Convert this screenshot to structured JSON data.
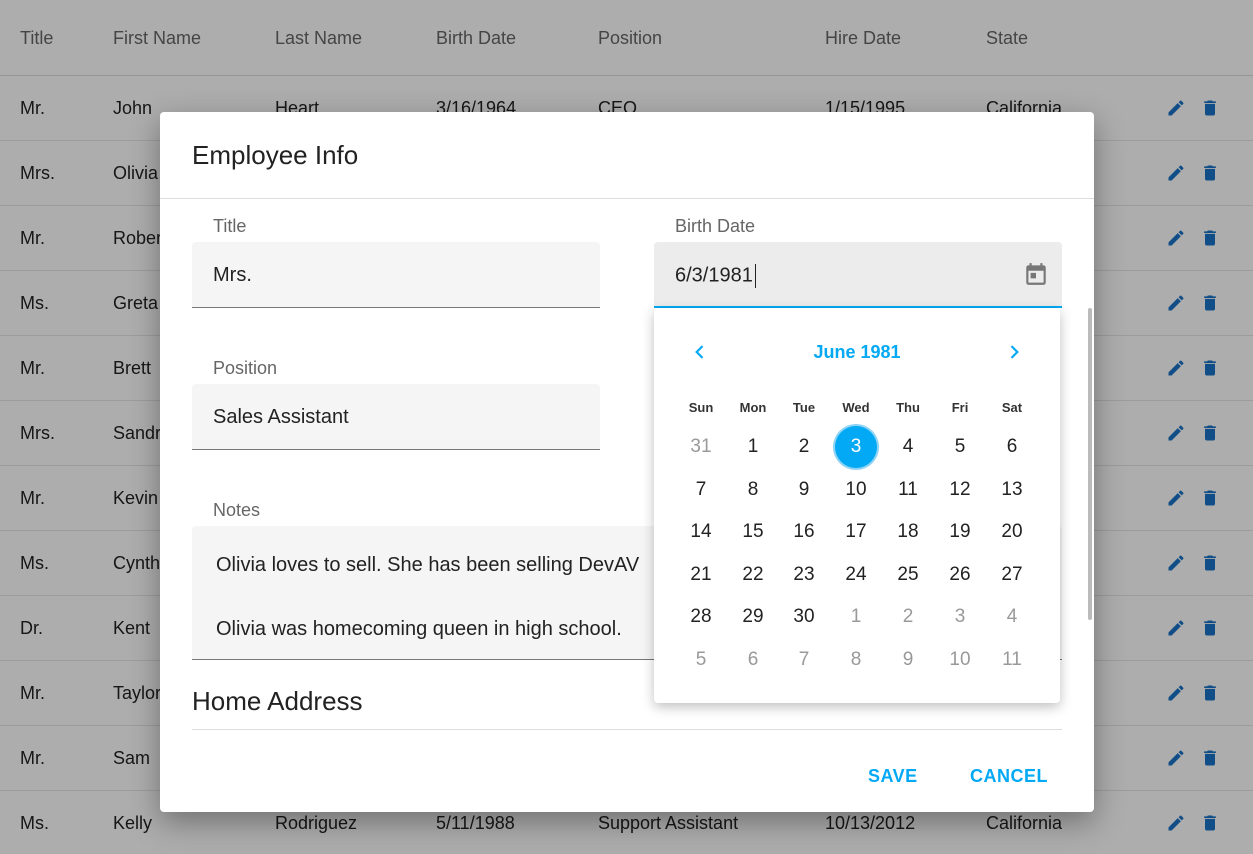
{
  "grid": {
    "columns": [
      "Title",
      "First Name",
      "Last Name",
      "Birth Date",
      "Position",
      "Hire Date",
      "State"
    ],
    "rows": [
      {
        "title": "Mr.",
        "first": "John",
        "last": "Heart",
        "birth": "3/16/1964",
        "position": "CEO",
        "hire": "1/15/1995",
        "state": "California"
      },
      {
        "title": "Mrs.",
        "first": "Olivia",
        "last": "",
        "birth": "",
        "position": "",
        "hire": "",
        "state": ""
      },
      {
        "title": "Mr.",
        "first": "Robert",
        "last": "",
        "birth": "",
        "position": "",
        "hire": "",
        "state": ""
      },
      {
        "title": "Ms.",
        "first": "Greta",
        "last": "",
        "birth": "",
        "position": "",
        "hire": "",
        "state": ""
      },
      {
        "title": "Mr.",
        "first": "Brett",
        "last": "",
        "birth": "",
        "position": "",
        "hire": "",
        "state": ""
      },
      {
        "title": "Mrs.",
        "first": "Sandra",
        "last": "",
        "birth": "",
        "position": "",
        "hire": "",
        "state": ""
      },
      {
        "title": "Mr.",
        "first": "Kevin",
        "last": "",
        "birth": "",
        "position": "",
        "hire": "",
        "state": ""
      },
      {
        "title": "Ms.",
        "first": "Cynthia",
        "last": "",
        "birth": "",
        "position": "",
        "hire": "",
        "state": ""
      },
      {
        "title": "Dr.",
        "first": "Kent",
        "last": "",
        "birth": "",
        "position": "",
        "hire": "",
        "state": ""
      },
      {
        "title": "Mr.",
        "first": "Taylor",
        "last": "",
        "birth": "",
        "position": "",
        "hire": "",
        "state": ""
      },
      {
        "title": "Mr.",
        "first": "Sam",
        "last": "",
        "birth": "",
        "position": "",
        "hire": "",
        "state": ""
      },
      {
        "title": "Ms.",
        "first": "Kelly",
        "last": "Rodriguez",
        "birth": "5/11/1988",
        "position": "Support Assistant",
        "hire": "10/13/2012",
        "state": "California"
      }
    ],
    "row_actions": {
      "edit_icon": "pencil-icon",
      "delete_icon": "trash-icon"
    }
  },
  "dialog": {
    "title": "Employee Info",
    "fields": {
      "title": {
        "label": "Title",
        "value": "Mrs."
      },
      "birth_date": {
        "label": "Birth Date",
        "value": "6/3/1981"
      },
      "position": {
        "label": "Position",
        "value": "Sales Assistant"
      },
      "notes": {
        "label": "Notes",
        "line1": "Olivia loves to sell. She has been selling DevAV",
        "line2": "Olivia was homecoming queen in high school."
      }
    },
    "section_title": "Home Address",
    "save_label": "SAVE",
    "cancel_label": "CANCEL"
  },
  "calendar": {
    "caption": "June 1981",
    "weekdays": [
      "Sun",
      "Mon",
      "Tue",
      "Wed",
      "Thu",
      "Fri",
      "Sat"
    ],
    "weeks": [
      [
        {
          "d": "31",
          "o": true
        },
        {
          "d": "1"
        },
        {
          "d": "2"
        },
        {
          "d": "3",
          "s": true
        },
        {
          "d": "4"
        },
        {
          "d": "5"
        },
        {
          "d": "6"
        }
      ],
      [
        {
          "d": "7"
        },
        {
          "d": "8"
        },
        {
          "d": "9"
        },
        {
          "d": "10"
        },
        {
          "d": "11"
        },
        {
          "d": "12"
        },
        {
          "d": "13"
        }
      ],
      [
        {
          "d": "14"
        },
        {
          "d": "15"
        },
        {
          "d": "16"
        },
        {
          "d": "17"
        },
        {
          "d": "18"
        },
        {
          "d": "19"
        },
        {
          "d": "20"
        }
      ],
      [
        {
          "d": "21"
        },
        {
          "d": "22"
        },
        {
          "d": "23"
        },
        {
          "d": "24"
        },
        {
          "d": "25"
        },
        {
          "d": "26"
        },
        {
          "d": "27"
        }
      ],
      [
        {
          "d": "28"
        },
        {
          "d": "29"
        },
        {
          "d": "30"
        },
        {
          "d": "1",
          "o": true
        },
        {
          "d": "2",
          "o": true
        },
        {
          "d": "3",
          "o": true
        },
        {
          "d": "4",
          "o": true
        }
      ],
      [
        {
          "d": "5",
          "o": true
        },
        {
          "d": "6",
          "o": true
        },
        {
          "d": "7",
          "o": true
        },
        {
          "d": "8",
          "o": true
        },
        {
          "d": "9",
          "o": true
        },
        {
          "d": "10",
          "o": true
        },
        {
          "d": "11",
          "o": true
        }
      ]
    ]
  },
  "colors": {
    "accent": "#03a9f4",
    "action_icon": "#1a73c7",
    "overlay": "rgba(0,0,0,0.32)"
  }
}
